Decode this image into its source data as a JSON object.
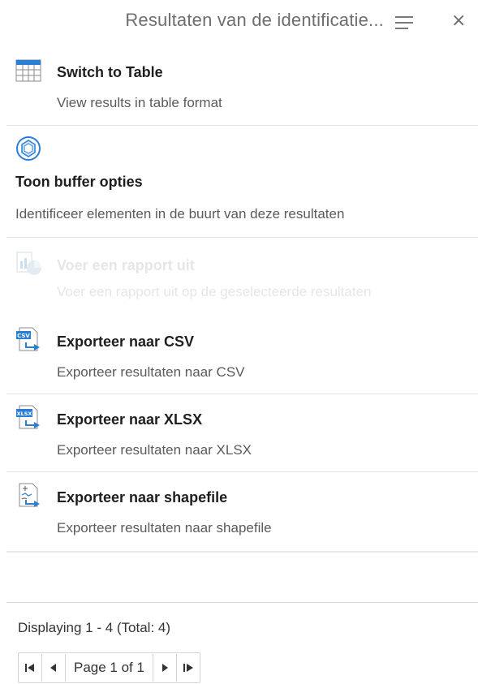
{
  "header": {
    "title": "Resultaten van de identificatie...",
    "menu_icon": "hamburger-menu-icon",
    "close_label": "×"
  },
  "items": [
    {
      "label": "Switch to Table",
      "description": "View results in table format",
      "icon": "table-icon",
      "enabled": true
    },
    {
      "label": "Toon buffer opties",
      "description": "Identificeer elementen in de buurt van deze resultaten",
      "icon": "buffer-icon",
      "enabled": true
    },
    {
      "label": "Voer een rapport uit",
      "description": "Voer een rapport uit op de geselecteerde resultaten",
      "icon": "report-icon",
      "enabled": false
    },
    {
      "label": "Exporteer naar CSV",
      "description": "Exporteer resultaten naar CSV",
      "icon": "csv-export-icon",
      "enabled": true
    },
    {
      "label": "Exporteer naar XLSX",
      "description": "Exporteer resultaten naar XLSX",
      "icon": "xlsx-export-icon",
      "enabled": true
    },
    {
      "label": "Exporteer naar shapefile",
      "description": "Exporteer resultaten naar shapefile",
      "icon": "shapefile-export-icon",
      "enabled": true
    }
  ],
  "footer": {
    "displaying": "Displaying 1 - 4 (Total: 4)",
    "page_label": "Page 1 of 1"
  },
  "colors": {
    "icon_blue": "#2a7fd4",
    "title_gray": "#6e6e6e",
    "disabled_text": "#e6e6e6"
  }
}
